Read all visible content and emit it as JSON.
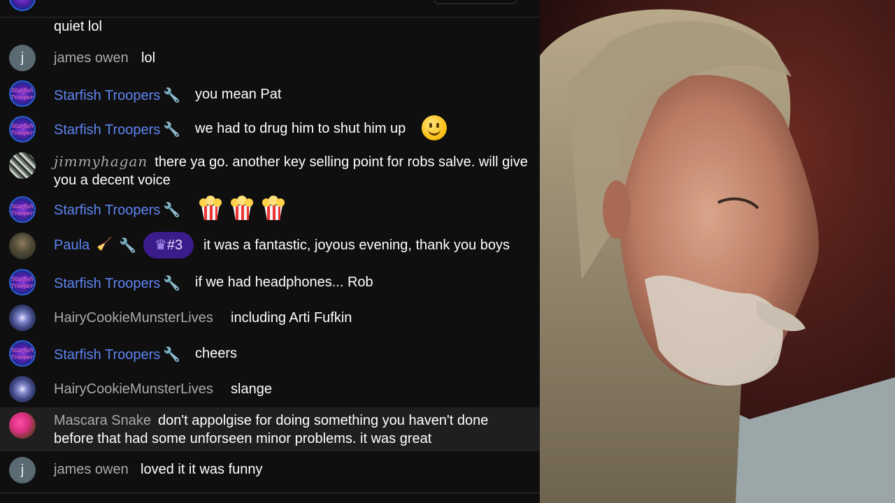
{
  "messages": [
    {
      "author": "",
      "text": "quiet lol"
    },
    {
      "author": "james owen",
      "avatar_initial": "j",
      "text": "lol"
    },
    {
      "author": "Starfish Troopers",
      "avatar_text": "Starfish Troopers",
      "text": "you mean Pat"
    },
    {
      "author": "Starfish Troopers",
      "text": "we had to drug him to shut him up",
      "emoji": "slightly-smiling-face"
    },
    {
      "author": "jimmyhagan",
      "text": "there ya go. another key selling point for robs salve. will give you a decent voice"
    },
    {
      "author": "Starfish Troopers",
      "text": "",
      "emoji": "popcorn x3"
    },
    {
      "author": "Paula",
      "badge": "#3",
      "text": "it was a fantastic, joyous evening, thank you boys"
    },
    {
      "author": "Starfish Troopers",
      "text": "if we had headphones... Rob"
    },
    {
      "author": "HairyCookieMunsterLives",
      "text": "including Arti Fufkin"
    },
    {
      "author": "Starfish Troopers",
      "text": "cheers"
    },
    {
      "author": "HairyCookieMunsterLives",
      "text": "slange"
    },
    {
      "author": "Mascara Snake",
      "text": "don't appolgise for doing something you haven't done before that had some unforseen minor problems. it was great"
    },
    {
      "author": "james owen",
      "avatar_initial": "j",
      "text": "loved it it was funny"
    }
  ],
  "colors": {
    "background": "#0f0f0f",
    "moderator_name": "#5e84f1",
    "member_name": "#aaaaaa",
    "message_text": "#ffffff",
    "badge_bg": "#3b1c8a",
    "highlight_row": "#1f1f1f"
  },
  "icons": [
    "wrench-icon",
    "crown-icon",
    "broom-icon"
  ]
}
